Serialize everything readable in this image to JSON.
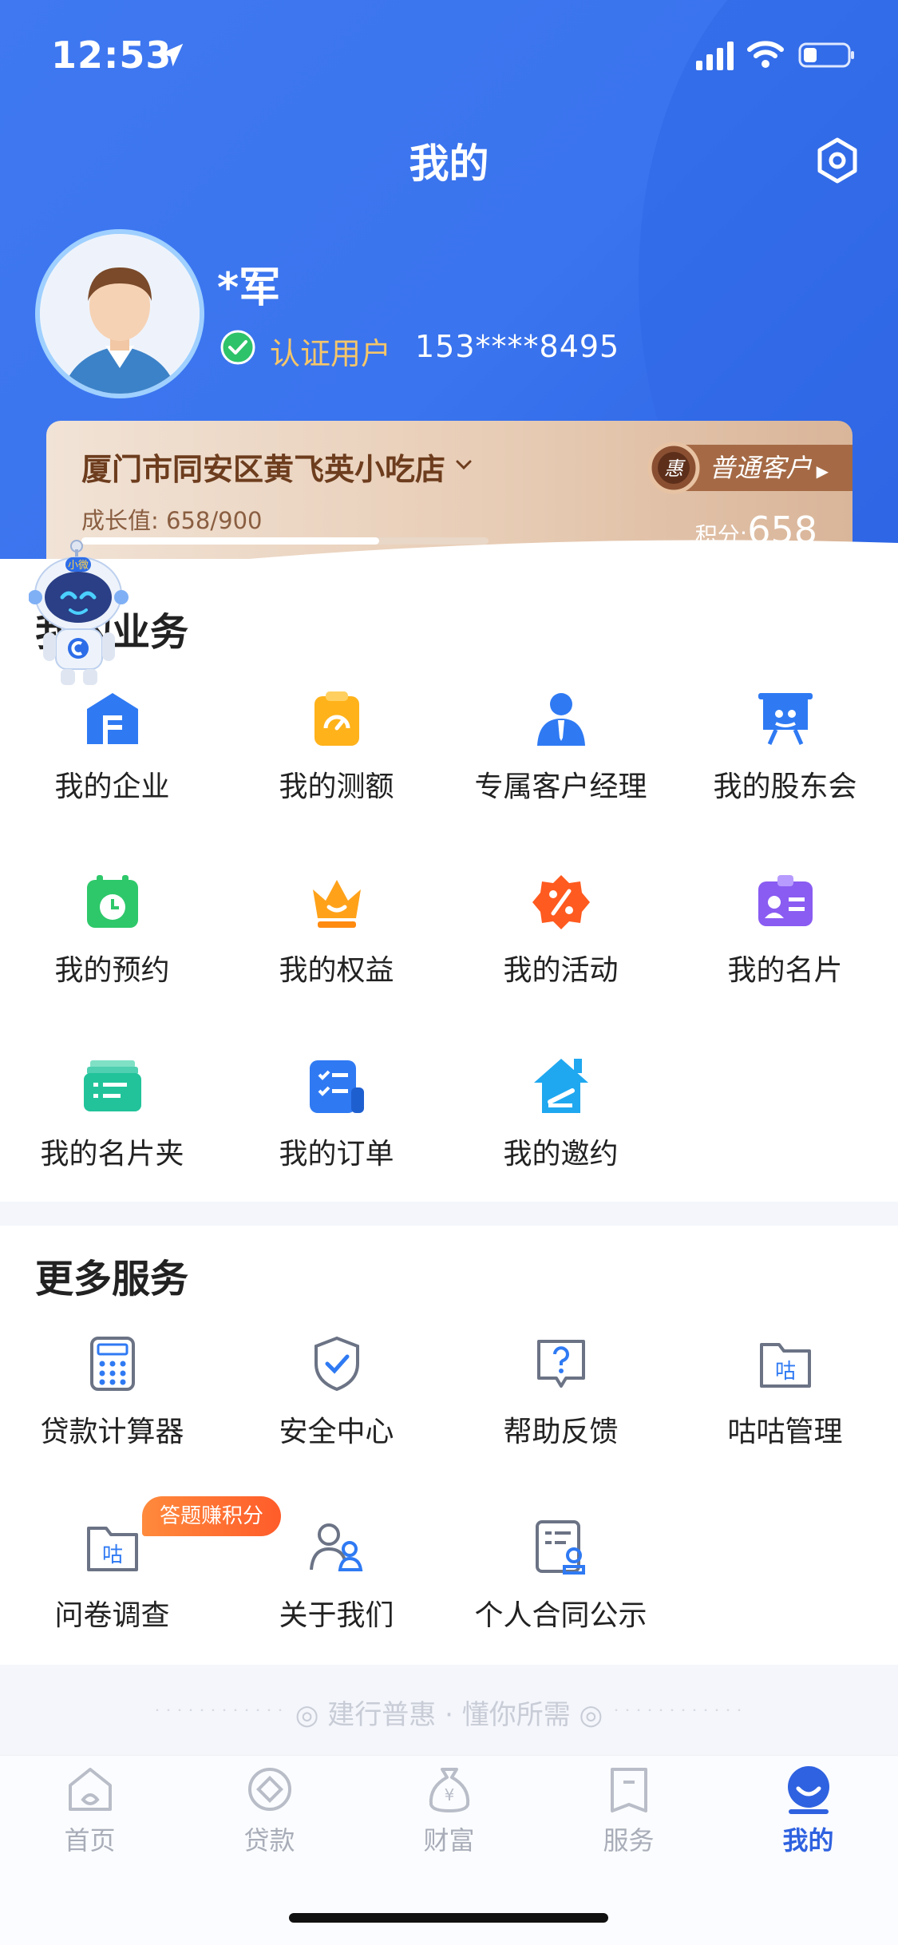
{
  "status_bar": {
    "time": "12:53"
  },
  "header": {
    "title": "我的"
  },
  "profile": {
    "name": "*军",
    "verified_label": "认证用户",
    "phone": "153****8495"
  },
  "member_card": {
    "shop_name": "厦门市同安区黄飞英小吃店",
    "tier": "普通客户",
    "medal_char": "惠",
    "growth_label": "成长值:",
    "growth_value": "658/900",
    "growth_progress": 0.731,
    "points_label": "积分:",
    "points_value": "658"
  },
  "robot": {
    "name": "小微"
  },
  "my_business": {
    "title": "我的业务",
    "items": [
      {
        "label": "我的企业",
        "icon": "building-icon"
      },
      {
        "label": "我的测额",
        "icon": "gauge-icon"
      },
      {
        "label": "专属客户经理",
        "icon": "manager-icon"
      },
      {
        "label": "我的股东会",
        "icon": "meeting-board-icon"
      },
      {
        "label": "我的预约",
        "icon": "calendar-clock-icon"
      },
      {
        "label": "我的权益",
        "icon": "crown-icon"
      },
      {
        "label": "我的活动",
        "icon": "percent-badge-icon"
      },
      {
        "label": "我的名片",
        "icon": "id-card-icon"
      },
      {
        "label": "我的名片夹",
        "icon": "card-folder-icon"
      },
      {
        "label": "我的订单",
        "icon": "order-list-icon"
      },
      {
        "label": "我的邀约",
        "icon": "invite-house-icon"
      }
    ]
  },
  "more_services": {
    "title": "更多服务",
    "items": [
      {
        "label": "贷款计算器",
        "icon": "calculator-icon"
      },
      {
        "label": "安全中心",
        "icon": "shield-check-icon"
      },
      {
        "label": "帮助反馈",
        "icon": "help-bubble-icon"
      },
      {
        "label": "咕咕管理",
        "icon": "gugu-folder-icon",
        "icon_char": "咕"
      },
      {
        "label": "问卷调查",
        "icon": "survey-folder-icon",
        "icon_char": "咕"
      },
      {
        "label": "关于我们",
        "icon": "people-icon"
      },
      {
        "label": "个人合同公示",
        "icon": "contract-icon"
      }
    ],
    "survey_badge": "答题赚积分"
  },
  "slogan": "建行普惠 · 懂你所需",
  "tabbar": {
    "tabs": [
      {
        "label": "首页",
        "icon": "home-icon"
      },
      {
        "label": "贷款",
        "icon": "loan-icon"
      },
      {
        "label": "财富",
        "icon": "money-bag-icon"
      },
      {
        "label": "服务",
        "icon": "service-icon"
      },
      {
        "label": "我的",
        "icon": "profile-icon",
        "active": true
      }
    ]
  },
  "colors": {
    "primary": "#3a74ee",
    "active_tab": "#2f62e0",
    "gold": "#f5c669",
    "badge": "#ff6a30"
  }
}
